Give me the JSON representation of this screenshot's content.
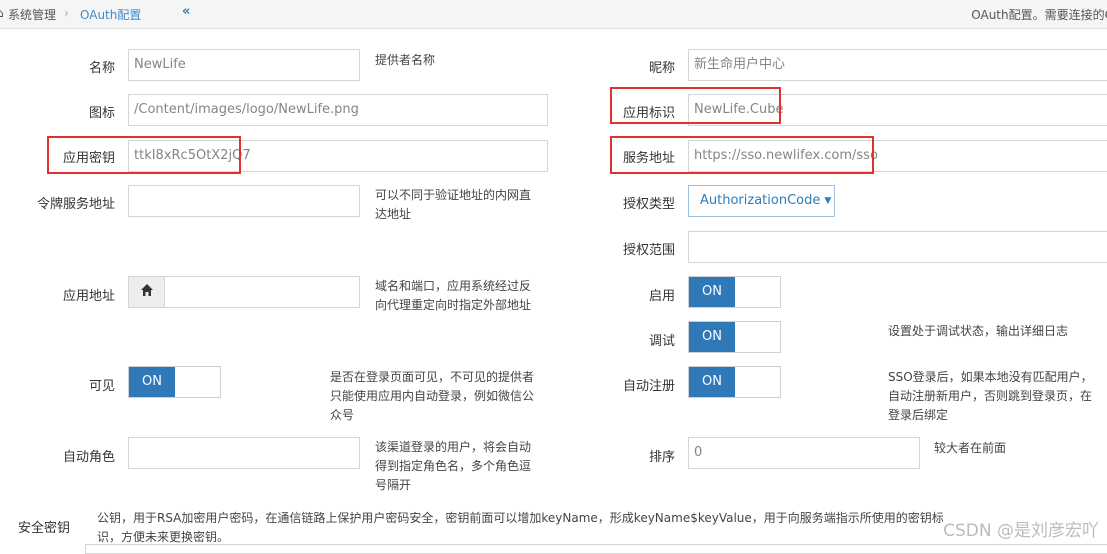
{
  "breadcrumb": {
    "home": "系统管理",
    "separator": "›",
    "current": "OAuth配置",
    "collapse_icon": "«"
  },
  "header_note": "OAuth配置。需要连接的C",
  "form": {
    "name": {
      "label": "名称",
      "value": "NewLife",
      "hint": "提供者名称"
    },
    "nickname": {
      "label": "昵称",
      "value": "新生命用户中心"
    },
    "icon": {
      "label": "图标",
      "value": "/Content/images/logo/NewLife.png"
    },
    "app_id": {
      "label": "应用标识",
      "value": "NewLife.Cube"
    },
    "app_secret": {
      "label": "应用密钥",
      "value": "ttkI8xRc5OtX2jQ7"
    },
    "server": {
      "label": "服务地址",
      "value": "https://sso.newlifex.com/sso"
    },
    "access_server": {
      "label": "令牌服务地址",
      "value": "",
      "hint_lines": [
        "可以不同于验证地址的内网直",
        "达地址"
      ]
    },
    "grant_type": {
      "label": "授权类型",
      "value": "AuthorizationCode"
    },
    "scope": {
      "label": "授权范围",
      "value": ""
    },
    "app_url": {
      "label": "应用地址",
      "value": "",
      "hint_lines": [
        "域名和端口，应用系统经过反",
        "向代理重定向时指定外部地址"
      ]
    },
    "enable": {
      "label": "启用",
      "state": "ON"
    },
    "debug": {
      "label": "调试",
      "state": "ON",
      "hint": "设置处于调试状态，输出详细日志"
    },
    "visible": {
      "label": "可见",
      "state": "ON",
      "hint_lines": [
        "是否在登录页面可见，不可见的提供者",
        "只能使用应用内自动登录，例如微信公",
        "众号"
      ]
    },
    "auto_register": {
      "label": "自动注册",
      "state": "ON",
      "hint_lines": [
        "SSO登录后，如果本地没有匹配用户，",
        "自动注册新用户，否则跳到登录页，在",
        "登录后绑定"
      ]
    },
    "auto_role": {
      "label": "自动角色",
      "value": "",
      "hint_lines": [
        "该渠道登录的用户，将会自动",
        "得到指定角色名，多个角色逗",
        "号隔开"
      ]
    },
    "sort": {
      "label": "排序",
      "value": "0",
      "hint": "较大者在前面"
    },
    "secret_key": {
      "label": "安全密钥",
      "hint_lines": [
        "公钥，用于RSA加密用户密码，在通信链路上保护用户密码安全，密钥前面可以增加keyName，形成keyName$keyValue，用于向服务端指示所使用的密钥标",
        "识，方便未来更换密钥。"
      ]
    }
  },
  "icons": {
    "app_url_addon": "home-icon",
    "grant_type_caret": "caret-down-icon"
  },
  "colors": {
    "toggle_on": "#2f79b8",
    "highlight_box": "#e0312e",
    "link": "#428bca"
  },
  "watermark": "CSDN @是刘彦宏吖"
}
